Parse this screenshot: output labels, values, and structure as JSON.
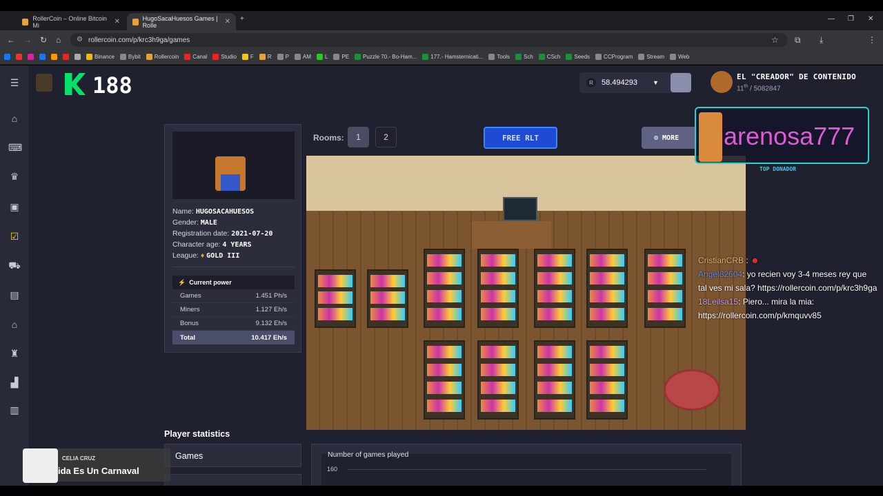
{
  "browser": {
    "tabs": [
      {
        "title": "RollerCoin – Online Bitcoin Mi"
      },
      {
        "title": "HugoSacaHuesos Games | Rolle"
      }
    ],
    "url": "rollercoin.com/p/krc3h9ga/games",
    "bookmarks": [
      "Binance",
      "Bybit",
      "Rollercoin",
      "Canal",
      "Studio",
      "F",
      "R",
      "P",
      "AM",
      "L",
      "PE",
      "Puzzle 70.- Bo-Ham...",
      "177.- Hamsternicati...",
      "Tools",
      "Sch",
      "CSch",
      "Seeds",
      "CCProgram",
      "Stream",
      "Web"
    ]
  },
  "header": {
    "level": "188",
    "balance": "58.494293",
    "balance_currency_icon": "R",
    "user_name": "EL \"CREADOR\" DE CONTENIDO",
    "user_rank_pos": "11",
    "user_rank_sup": "th",
    "user_rank_total": "/ 5082847"
  },
  "profile": {
    "name_label": "Name:",
    "name": "HUGOSACAHUESOS",
    "gender_label": "Gender:",
    "gender": "MALE",
    "registration_label": "Registration date:",
    "registration": "2021-07-20",
    "age_label": "Character age:",
    "age": "4 YEARS",
    "league_label": "League:",
    "league": "GOLD III",
    "power_title": "Current power",
    "power_rows": [
      {
        "label": "Games",
        "value": "1.451 Ph/s"
      },
      {
        "label": "Miners",
        "value": "1.127 Eh/s"
      },
      {
        "label": "Bonus",
        "value": "9.132 Eh/s"
      },
      {
        "label": "Total",
        "value": "10.417 Eh/s"
      }
    ]
  },
  "rooms": {
    "label": "Rooms:",
    "room1": "1",
    "room2": "2",
    "free_rlt": "FREE RLT",
    "more": "MORE"
  },
  "overlay": {
    "donor_name": "arenosa777",
    "donor_caption": "TOP DONADOR"
  },
  "chat": [
    {
      "user": "CristianCRB",
      "text": ":"
    },
    {
      "user": "Angel82604",
      "text": ": yo recien voy 3-4 meses rey que tal ves mi sala? https://rollercoin.com/p/krc3h9ga"
    },
    {
      "user": "18Leilsa15",
      "text": ": Piero... mira la mia: https://rollercoin.com/p/kmquvv85"
    }
  ],
  "stats": {
    "title": "Player statistics",
    "games_tab": "Games",
    "chart_title": "Number of games played",
    "chart_tick": "160"
  },
  "music": {
    "artist": "CELIA CRUZ",
    "title": "ida Es Un Carnaval"
  }
}
